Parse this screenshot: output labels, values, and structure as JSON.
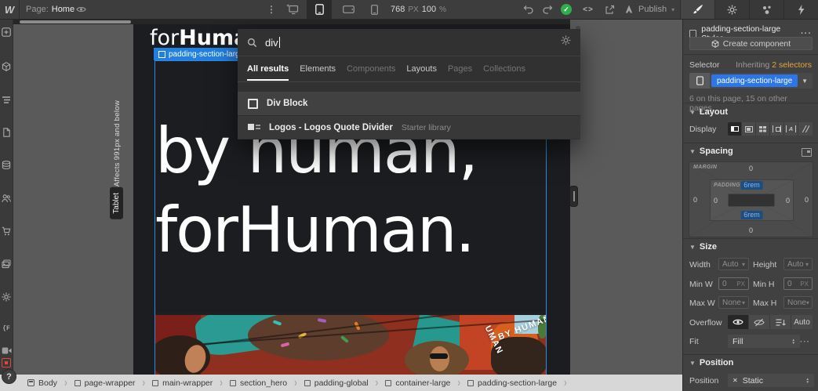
{
  "topbar": {
    "brand": "W",
    "page_label": "Page:",
    "page_name": "Home",
    "canvas_width": "768",
    "width_unit": "PX",
    "zoom_value": "100",
    "zoom_unit": "%",
    "code_glyph": "<>",
    "publish_label": "Publish"
  },
  "search_panel": {
    "query": "div",
    "tabs": [
      "All results",
      "Elements",
      "Components",
      "Layouts",
      "Pages",
      "Collections"
    ],
    "results": [
      {
        "title": "Div Block",
        "meta": ""
      },
      {
        "title": "Logos - Logos Quote Divider",
        "meta": "Starter library"
      }
    ]
  },
  "canvas": {
    "breakpoint_note": "Affects 991px and below",
    "breakpoint_badge": "Tablet",
    "element_label": "padding-section-large",
    "site_logo_regular": "for",
    "site_logo_bold": "Human",
    "heading_line1": "by human,",
    "heading_line2": "forHuman.",
    "rotating_badge_text_1": "· BY HUMAN",
    "rotating_badge_text_2": "UMAN"
  },
  "style_panel": {
    "styles_header": "padding-section-large Styles",
    "create_component_label": "Create component",
    "selector_label": "Selector",
    "inheriting_label": "Inheriting",
    "inheriting_count": "2 selectors",
    "selector_value": "padding-section-large",
    "usage_note": "6 on this page, 15 on other pages.",
    "sections": {
      "layout": "Layout",
      "spacing": "Spacing",
      "size": "Size",
      "position": "Position"
    },
    "display_label": "Display",
    "spacing": {
      "margin_label": "MARGIN",
      "padding_label": "PADDING",
      "margin_top": "0",
      "margin_right": "0",
      "margin_bottom": "0",
      "margin_left": "0",
      "padding_top": "6rem",
      "padding_right": "0",
      "padding_bottom": "6rem",
      "padding_left": "0"
    },
    "size": {
      "width_label": "Width",
      "width_value": "Auto",
      "height_label": "Height",
      "height_value": "Auto",
      "min_w_label": "Min W",
      "min_w_value": "0",
      "min_w_unit": "PX",
      "min_h_label": "Min H",
      "min_h_value": "0",
      "min_h_unit": "PX",
      "max_w_label": "Max W",
      "max_w_value": "None",
      "max_h_label": "Max H",
      "max_h_value": "None"
    },
    "overflow_label": "Overflow",
    "overflow_auto": "Auto",
    "fit_label": "Fit",
    "fit_value": "Fill",
    "position_label": "Position",
    "position_value": "Static"
  },
  "breadcrumb": {
    "items": [
      "Body",
      "page-wrapper",
      "main-wrapper",
      "section_hero",
      "padding-global",
      "container-large",
      "padding-section-large"
    ]
  },
  "icons": [
    "webflow-logo",
    "preview-eye",
    "breakpoint-desktop",
    "breakpoint-tablet",
    "breakpoint-landscape",
    "breakpoint-portrait",
    "undo",
    "redo",
    "saved-check",
    "code",
    "export",
    "publish-rocket",
    "style-brush",
    "settings-gear",
    "interactions-drops",
    "variables-bolt",
    "add-elements",
    "components-cube",
    "navigator",
    "pages",
    "cms-database",
    "users",
    "ecommerce-cart",
    "assets",
    "logic",
    "screen-record",
    "find",
    "video",
    "help",
    "search-magnifier",
    "div-block",
    "logos-divider"
  ],
  "colors": {
    "accent_blue": "#2b77e8",
    "warning_orange": "#e8a33d",
    "publish_green": "#2fae4e",
    "record_red": "#e04540",
    "canvas_bg": "#1b1d20"
  }
}
